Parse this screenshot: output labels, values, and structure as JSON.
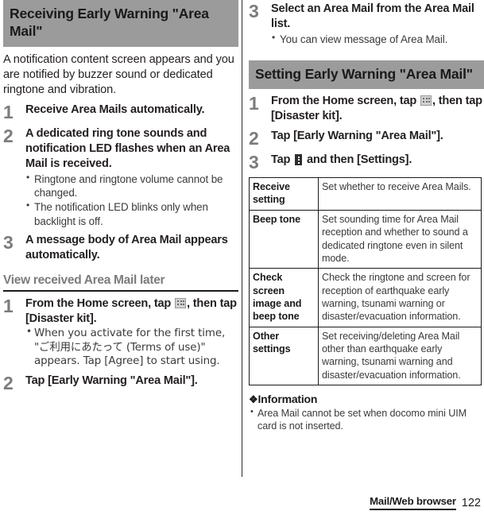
{
  "left_column": {
    "section_title": "Receiving Early Warning \"Area Mail\"",
    "intro": "A notification content screen appears and you are notified by buzzer sound or dedicated ringtone and vibration.",
    "steps": [
      {
        "num": "1",
        "title": "Receive Area Mails automatically.",
        "bullets": []
      },
      {
        "num": "2",
        "title": "A dedicated ring tone sounds and notification LED flashes when an Area Mail is received.",
        "bullets": [
          "Ringtone and ringtone volume cannot be changed.",
          "The notification LED blinks only when backlight is off."
        ]
      },
      {
        "num": "3",
        "title": "A message body of Area Mail appears automatically.",
        "bullets": []
      }
    ],
    "subsection_title": "View received Area Mail later",
    "sub_steps": [
      {
        "num": "1",
        "title_before_icon": "From the Home screen, tap ",
        "icon": "app-drawer-icon",
        "title_after_icon": ", then tap [Disaster kit].",
        "bullets": [
          "When you activate for the first time, \"ご利用にあたって (Terms of use)\" appears. Tap [Agree] to start using."
        ]
      },
      {
        "num": "2",
        "title": "Tap [Early Warning \"Area Mail\"].",
        "bullets": []
      }
    ]
  },
  "right_column": {
    "continued_step": {
      "num": "3",
      "title": "Select an Area Mail from the Area Mail list.",
      "bullets": [
        "You can view message of Area Mail."
      ]
    },
    "section_title": "Setting Early Warning \"Area Mail\"",
    "steps": [
      {
        "num": "1",
        "title_before_icon": "From the Home screen, tap ",
        "icon": "app-drawer-icon",
        "title_after_icon": ", then tap [Disaster kit]."
      },
      {
        "num": "2",
        "title": "Tap [Early Warning \"Area Mail\"]."
      },
      {
        "num": "3",
        "title_before_icon": "Tap ",
        "icon": "overflow-menu-icon",
        "title_after_icon": " and then [Settings]."
      }
    ],
    "settings_table": {
      "rows": [
        {
          "key": "Receive setting",
          "value": "Set whether to receive Area Mails."
        },
        {
          "key": "Beep tone",
          "value": "Set sounding time for Area Mail reception and whether to sound a dedicated ringtone even in silent mode."
        },
        {
          "key": "Check screen image and beep tone",
          "value": "Check the ringtone and screen for reception of earthquake early warning, tsunami warning or disaster/evacuation information."
        },
        {
          "key": "Other settings",
          "value": "Set receiving/deleting Area Mail other than earthquake early warning, tsunami warning and disaster/evacuation information."
        }
      ]
    },
    "information": {
      "diamond": "❖",
      "heading": "Information",
      "items": [
        "Area Mail cannot be set when docomo mini UIM card is not inserted."
      ]
    }
  },
  "footer": {
    "chapter": "Mail/Web browser",
    "page": "122"
  },
  "colors": {
    "section_bar_bg": "#9b9b9b",
    "step_number": "#7c7c7c",
    "subhead": "#7c7c7c",
    "body_text": "#231f20",
    "rule": "#1a1a1a"
  }
}
